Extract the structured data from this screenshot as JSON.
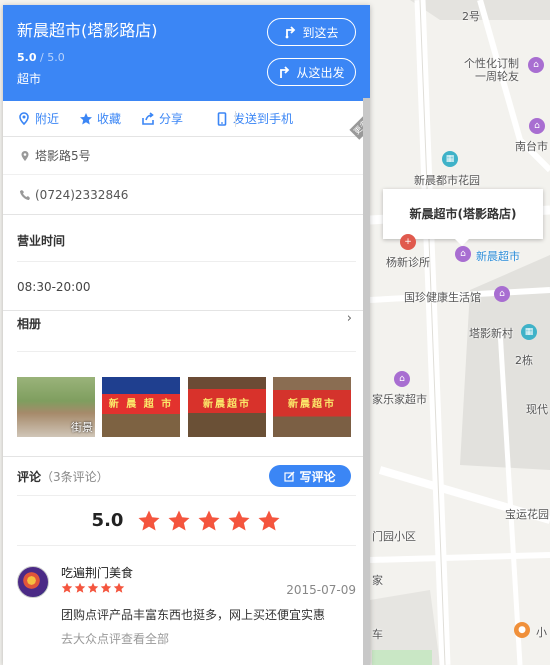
{
  "place": {
    "name": "新晨超市(塔影路店)",
    "score": "5.0",
    "score_total": " / 5.0",
    "category": "超市",
    "btn_go_here": "到这去",
    "btn_from_here": "从这出发"
  },
  "actions": {
    "nearby": "附近",
    "favorite": "收藏",
    "share": "分享",
    "send_phone": "发送到手机",
    "more": "更多"
  },
  "info": {
    "address": "塔影路5号",
    "phone": "(0724)2332846"
  },
  "hours": {
    "title": "营业时间",
    "value": "08:30-20:00"
  },
  "photos": {
    "title": "相册",
    "chevron": "›",
    "items": [
      {
        "sign": "",
        "tag": "街景"
      },
      {
        "sign": "新 晨 超 市",
        "tag": ""
      },
      {
        "sign": "新晨超市",
        "tag": ""
      },
      {
        "sign": "新晨超市",
        "tag": ""
      }
    ]
  },
  "reviews": {
    "title": "评论",
    "count": "（3条评论）",
    "write": "写评论",
    "overall": "5.0",
    "overall_stars": 5,
    "items": [
      {
        "user": "吃遍荆门美食",
        "stars": 5,
        "date": "2015-07-09",
        "text": "团购点评产品丰富东西也挺多，网上买还便宜实惠",
        "more": "去大众点评查看全部"
      }
    ]
  },
  "map": {
    "popup": "新晨超市(塔影路店)",
    "labels": {
      "l1": "2号",
      "l2": "个性化订制",
      "l3": "一周轮友",
      "l4": "南台市",
      "l5": "新晨都市花园",
      "l6": "杨新诊所",
      "l7": "新晨超市",
      "l8": "国珍健康生活馆",
      "l9": "塔影新村",
      "l10": "2栋",
      "l11": "家乐家超市",
      "l12": "现代",
      "l13": "宝运花园",
      "l14": "门园小区",
      "l15": "家",
      "l16": "车",
      "l17": "小"
    }
  },
  "colors": {
    "accent": "#3b86f5",
    "star": "#f4553e",
    "poi_purple": "#a86ed1"
  }
}
